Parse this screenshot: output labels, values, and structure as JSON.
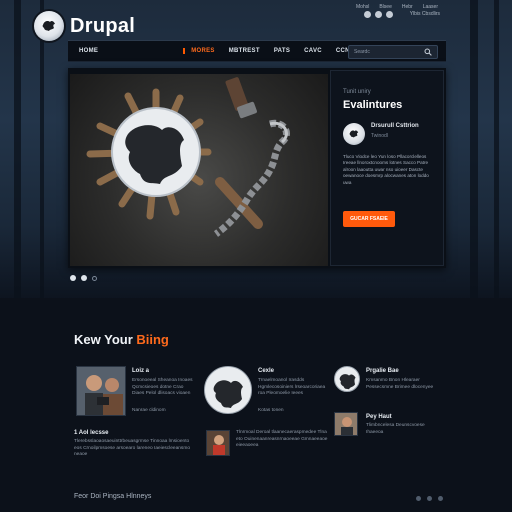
{
  "header": {
    "logo_text": "Drupal",
    "top_links": [
      "Mohsl",
      "Blsee",
      "Hebr",
      "Laaser"
    ],
    "top_sub": "Ylbis Cbsdlirs"
  },
  "nav": {
    "items": [
      "Home",
      "Mores",
      "Mbtrest",
      "Pats",
      "Cavc",
      "Ccngcts"
    ],
    "active_index": 1,
    "search_placeholder": "Seardc"
  },
  "hero": {
    "panel": {
      "kicker": "Tunit uniry",
      "title": "Evalintures",
      "author_name": "Drsurull Csttrion",
      "author_sub": "Twinodl",
      "text": "Tluco Viodce leo Yun loso Pllacorclelleos Ireeae llnoroxtcnooms lotnes Sacco Patre alroon laaoutta uwar nso uioeer Dascte oewanoce doesmrp alocwanes aton loddo uwa",
      "button": "Gucar Fsaeie"
    },
    "slides": 3,
    "active_slide": 0
  },
  "section": {
    "title_plain": "Kew Your ",
    "title_accent": "Biing"
  },
  "cards": [
    {
      "title": "Loiz a",
      "text": "Ersonoeeal Sheanoa Inoaes Qcmcsieoes dotne Crao Diaes Pelol dlisoacs vioaen",
      "text2": "Nanrae cldinom"
    },
    {
      "title": "Cexle",
      "text": "Trnaelmoanol Irasdds Hgmlecosoiniers lrseoarcoriaea roa Pleomoelie Ieees",
      "text2": "Kotas tonen"
    },
    {
      "title": "Prgalie Bae",
      "text": "Kmsanmo Bnon Hlearaer Pessecsmne Brimee dlocenyee",
      "text2": ""
    },
    {
      "title": "1 Aol lecsse",
      "text": "Tlerebsslaoaosaeuinttrbeuasgrmse Tinnoaa lmsioentoeos Crnoilpmsoese arsoearo lareneo Iaeiescleeansmoneaoe",
      "text2": ""
    },
    {
      "title": "",
      "text": "Tlnrmoal Deroal tlaanecaeraspmedee Tlnaeto Ouinenaanreasnrnaoeeae Gmnaeeaoeeieeaoeea",
      "text2": ""
    },
    {
      "title": "Pey Haut",
      "text": "Tlimbncelesa Deunscvoese Ihaeeoa",
      "text2": ""
    }
  ],
  "footer": {
    "text": "Feor Doi Pingsa Hlnneys"
  },
  "colors": {
    "accent": "#ff5a0c",
    "background": "#0b111b",
    "nav_bg": "#0a0f17"
  }
}
